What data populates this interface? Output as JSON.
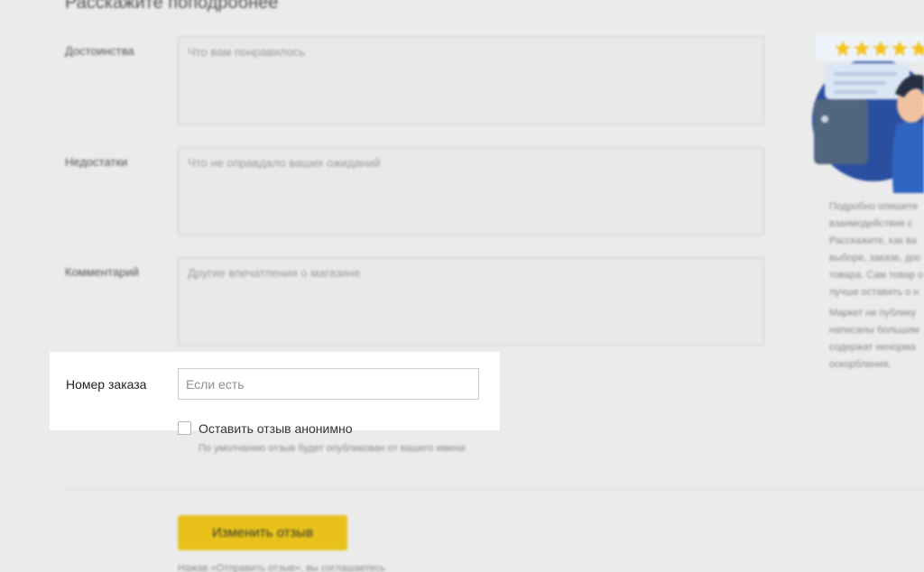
{
  "section_title": "Расскажите поподробнее",
  "fields": [
    {
      "label": "Достоинства",
      "placeholder": "Что вам понравилось"
    },
    {
      "label": "Недостатки",
      "placeholder": "Что не оправдало ваших ожиданий"
    },
    {
      "label": "Комментарий",
      "placeholder": "Другие впечатления о магазине"
    }
  ],
  "order": {
    "label": "Номер заказа",
    "placeholder": "Если есть",
    "value": ""
  },
  "anonymous": {
    "label": "Оставить отзыв анонимно",
    "checked": false,
    "hint": "По умолчанию отзыв будет опубликован от вашего имени"
  },
  "submit": {
    "label": "Изменить отзыв",
    "color": "#e8c21b"
  },
  "footer_note": "Нажав «Отправить отзыв», вы соглашаетесь",
  "sidebar": {
    "rating_stars": 5,
    "tips_paragraph_1": [
      "Подробно опишите",
      "взаимодействия с",
      "Расскажите, как ва",
      "выборе, заказе, дос",
      "товара. Сам товар о",
      "лучше оставить о н"
    ],
    "tips_paragraph_2": [
      "Маркет не публику",
      "написаны большим",
      "содержат ненорма",
      "оскорбления."
    ]
  },
  "colors": {
    "highlight": "#ffffff",
    "background": "#ebebeb",
    "star": "#f4c21f",
    "accent_circle": "#2b4fa0"
  }
}
